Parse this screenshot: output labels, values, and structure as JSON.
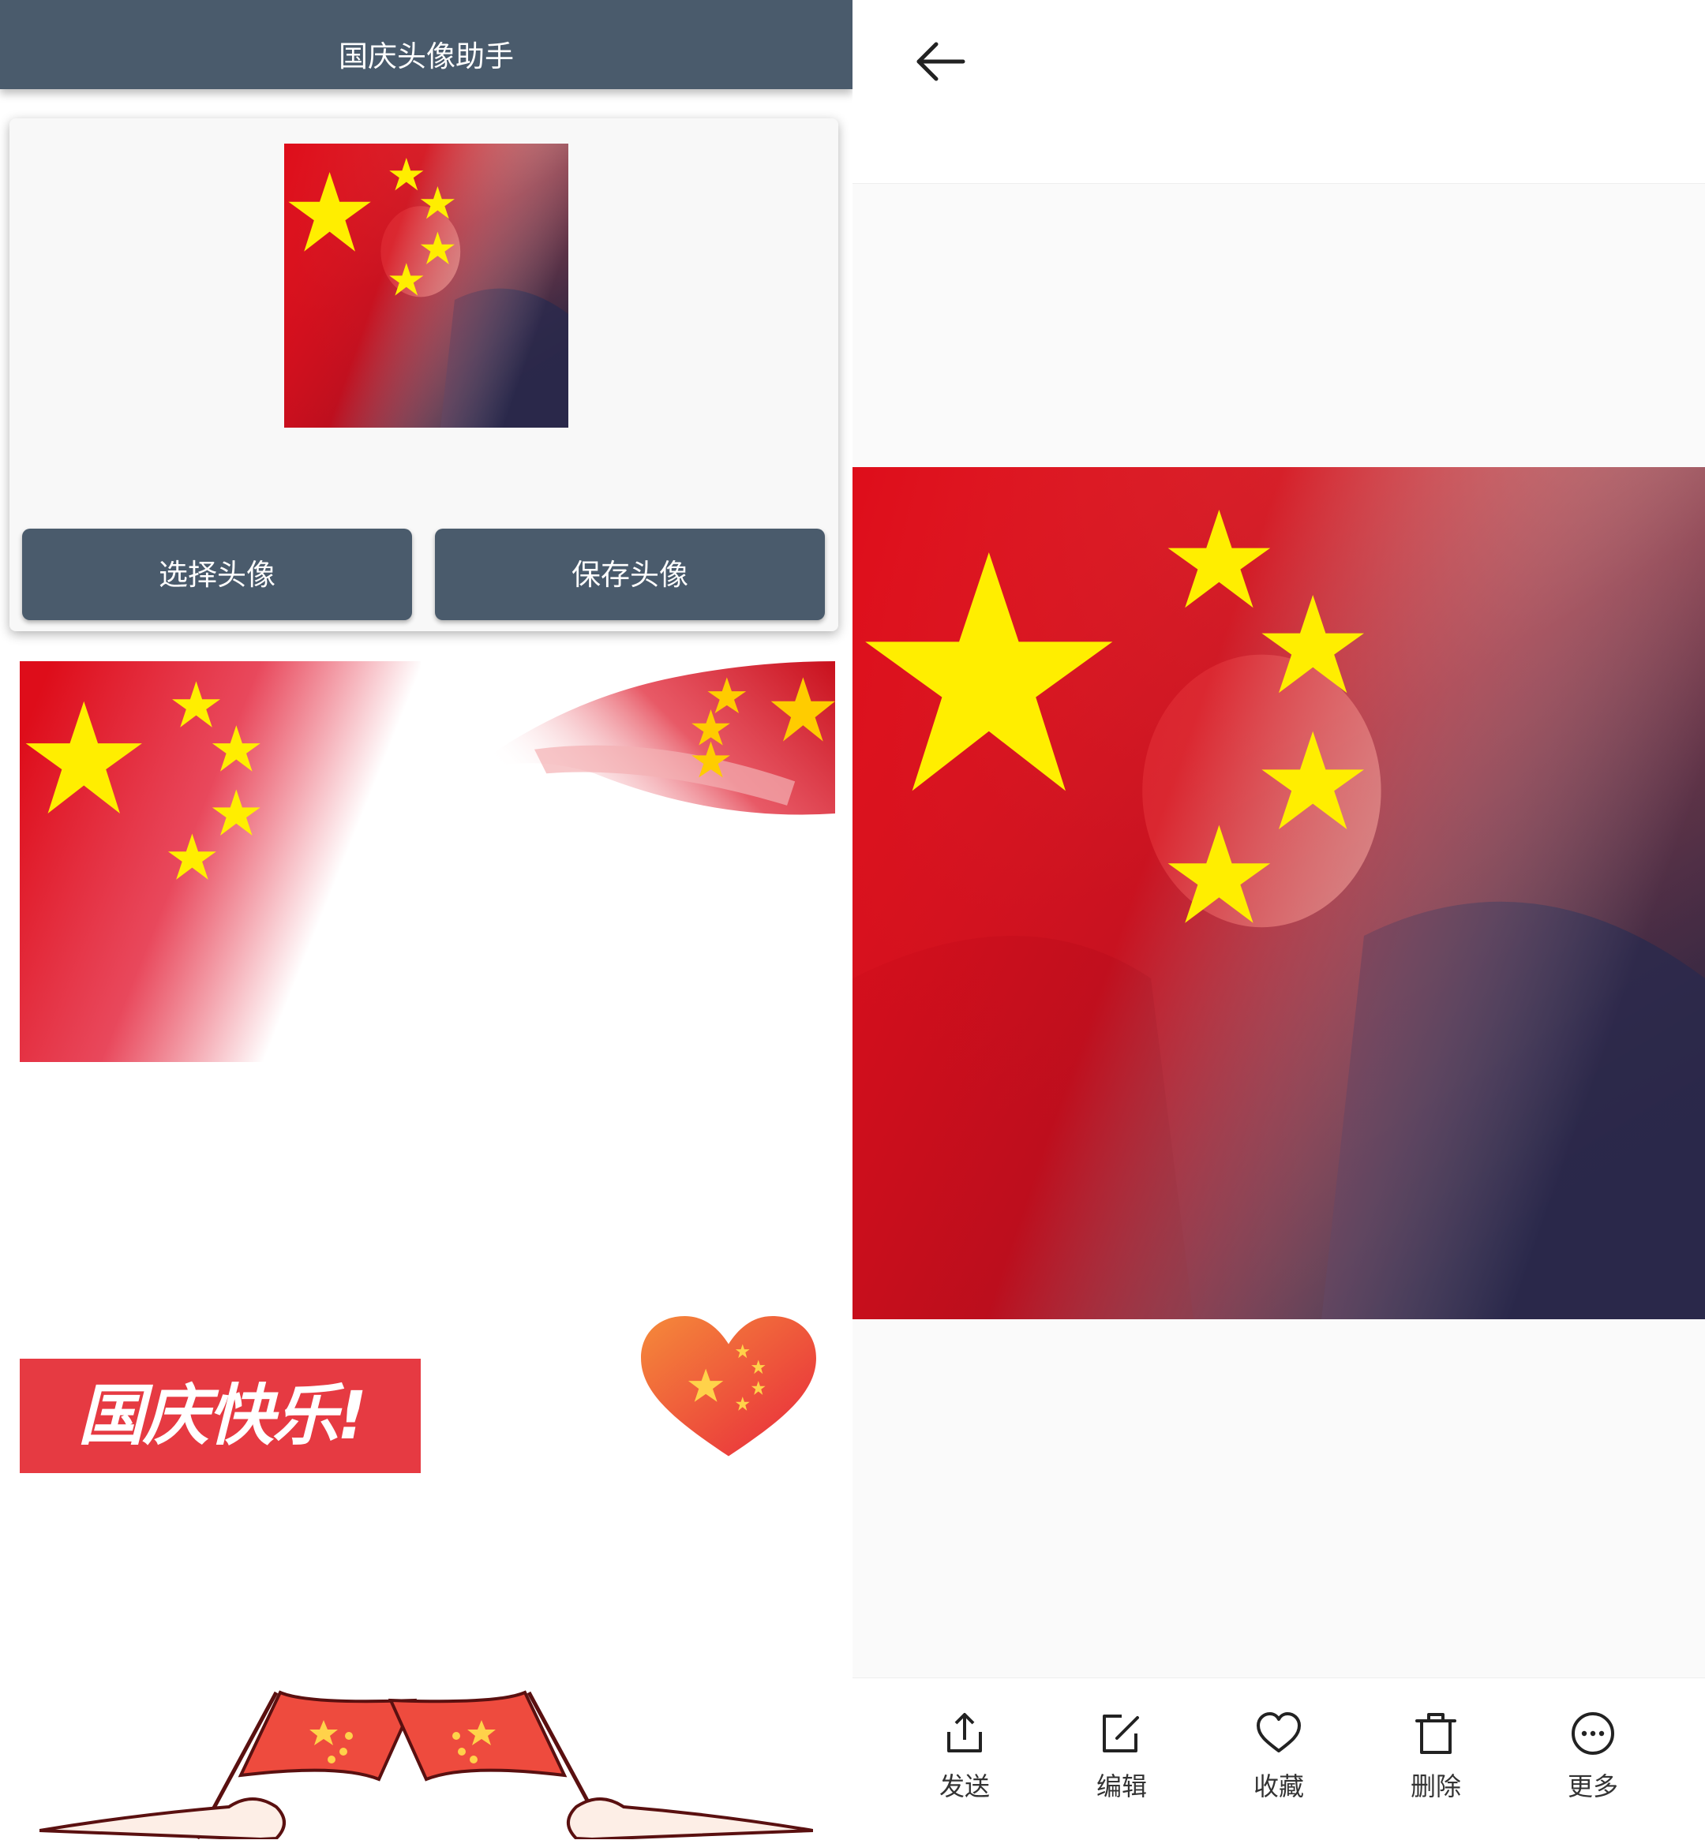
{
  "app": {
    "title": "国庆头像助手",
    "select_button": "选择头像",
    "save_button": "保存头像"
  },
  "frames": {
    "banner_text": "国庆快乐!"
  },
  "viewer": {
    "actions": [
      {
        "label": "发送",
        "icon": "share-icon"
      },
      {
        "label": "编辑",
        "icon": "edit-icon"
      },
      {
        "label": "收藏",
        "icon": "heart-icon"
      },
      {
        "label": "删除",
        "icon": "trash-icon"
      },
      {
        "label": "更多",
        "icon": "more-icon"
      }
    ]
  },
  "colors": {
    "appbar": "#4a5b6c",
    "flag_red": "#de0d1a",
    "star_yellow": "#ffee00"
  }
}
